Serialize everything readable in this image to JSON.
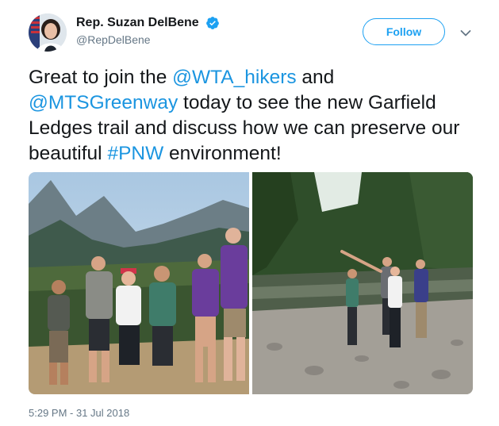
{
  "author": {
    "display_name": "Rep. Suzan DelBene",
    "handle": "@RepDelBene",
    "verified": true,
    "avatar_icon": "user-avatar"
  },
  "follow_button": {
    "label": "Follow"
  },
  "menu": {
    "icon": "chevron-down-icon"
  },
  "tweet": {
    "segments": [
      {
        "text": "Great to join the ",
        "type": "text"
      },
      {
        "text": "@WTA_hikers",
        "type": "mention"
      },
      {
        "text": " and ",
        "type": "text"
      },
      {
        "text": "@MTSGreenway",
        "type": "mention"
      },
      {
        "text": " today to see the new Garfield Ledges trail and discuss how we can preserve our beautiful ",
        "type": "text"
      },
      {
        "text": "#PNW",
        "type": "hashtag"
      },
      {
        "text": " environment!",
        "type": "text"
      }
    ]
  },
  "media": {
    "photos": [
      {
        "alt_name": "group-photo-mountain-valley"
      },
      {
        "alt_name": "group-photo-river-bank"
      }
    ]
  },
  "timestamp": "5:29 PM - 31 Jul 2018",
  "colors": {
    "link": "#1b95e0",
    "verified": "#1da1f2",
    "text": "#14171a",
    "muted": "#657786"
  }
}
